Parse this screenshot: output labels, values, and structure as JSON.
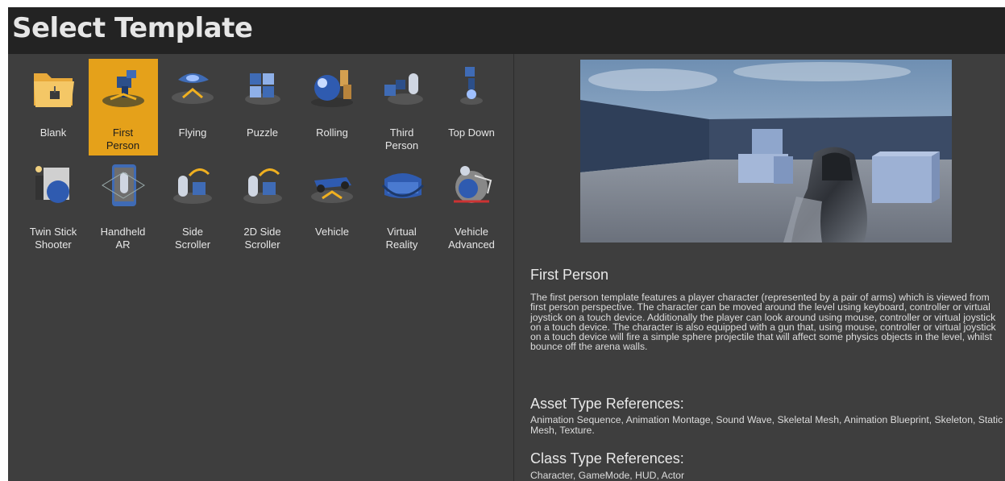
{
  "window": {
    "title": "Select Template"
  },
  "templates": [
    {
      "label": "Blank",
      "icon": "folder-icon",
      "selected": false
    },
    {
      "label": "First\nPerson",
      "icon": "first-person-icon",
      "selected": true
    },
    {
      "label": "Flying",
      "icon": "flying-icon",
      "selected": false
    },
    {
      "label": "Puzzle",
      "icon": "puzzle-icon",
      "selected": false
    },
    {
      "label": "Rolling",
      "icon": "rolling-icon",
      "selected": false
    },
    {
      "label": "Third\nPerson",
      "icon": "third-person-icon",
      "selected": false
    },
    {
      "label": "Top Down",
      "icon": "top-down-icon",
      "selected": false
    },
    {
      "label": "Twin Stick\nShooter",
      "icon": "twin-stick-icon",
      "selected": false
    },
    {
      "label": "Handheld\nAR",
      "icon": "handheld-ar-icon",
      "selected": false
    },
    {
      "label": "Side\nScroller",
      "icon": "side-scroller-icon",
      "selected": false
    },
    {
      "label": "2D Side\nScroller",
      "icon": "2d-side-scroller-icon",
      "selected": false
    },
    {
      "label": "Vehicle",
      "icon": "vehicle-icon",
      "selected": false
    },
    {
      "label": "Virtual\nReality",
      "icon": "vr-headset-icon",
      "selected": false
    },
    {
      "label": "Vehicle\nAdvanced",
      "icon": "vehicle-advanced-icon",
      "selected": false
    }
  ],
  "details": {
    "title": "First Person",
    "description": "The first person template features a player character (represented by a pair of arms) which is viewed from first person perspective. The character can be moved around the level using keyboard, controller or virtual joystick on a touch device. Additionally the player can look around using mouse, controller or virtual joystick on a touch device. The character is also equipped with a gun that, using mouse,  controller or virtual joystick on a touch device will fire a simple sphere projectile that will affect some physics objects in the level, whilst bounce off the arena walls.",
    "asset_heading": "Asset Type References:",
    "asset_refs": "Animation Sequence, Animation Montage, Sound Wave, Skeletal Mesh, Animation Blueprint, Skeleton, Static Mesh, Texture.",
    "class_heading": "Class Type References:",
    "class_refs": "Character, GameMode, HUD, Actor"
  },
  "colors": {
    "selection": "#e5a11a",
    "panel": "#3e3e3e",
    "titlebar": "#232323"
  }
}
